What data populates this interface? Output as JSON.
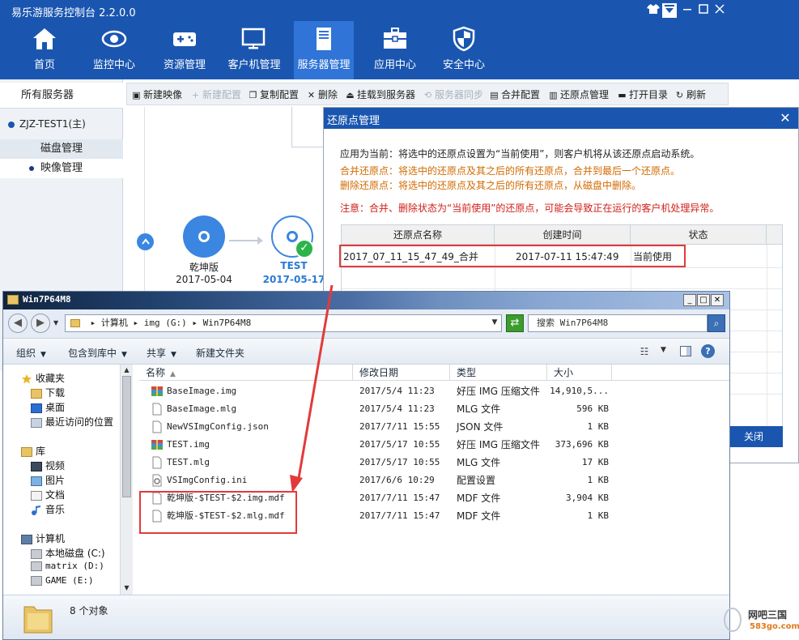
{
  "app": {
    "title": "易乐游服务控制台 2.2.0.0",
    "nav": [
      {
        "label": "首页",
        "icon": "home-icon"
      },
      {
        "label": "监控中心",
        "icon": "eye-icon"
      },
      {
        "label": "资源管理",
        "icon": "gamepad-icon"
      },
      {
        "label": "客户机管理",
        "icon": "monitor-icon"
      },
      {
        "label": "服务器管理",
        "icon": "server-icon",
        "active": true
      },
      {
        "label": "应用中心",
        "icon": "toolbox-icon"
      },
      {
        "label": "安全中心",
        "icon": "shield-icon"
      }
    ]
  },
  "sidebar": {
    "all_servers": "所有服务器",
    "server": "ZJZ-TEST1(主)",
    "disk_mgmt": "磁盘管理",
    "image_mgmt": "映像管理"
  },
  "toolbar": {
    "new_image": "新建映像",
    "new_config": "新建配置",
    "copy_config": "复制配置",
    "delete": "删除",
    "mount": "挂载到服务器",
    "sync": "服务器同步",
    "merge": "合并配置",
    "restore_mgmt": "还原点管理",
    "open_dir": "打开目录",
    "refresh": "刷新"
  },
  "canvas": {
    "node_a": {
      "name": "乾坤版",
      "date": "2017-05-04"
    },
    "node_b": {
      "name": "TEST",
      "date": "2017-05-17"
    }
  },
  "dialog": {
    "title": "还原点管理",
    "line1": "应用为当前：将选中的还原点设置为“当前使用”，则客户机将从该还原点启动系统。",
    "line2": "合并还原点：将选中的还原点及其之后的所有还原点，合并到最后一个还原点。",
    "line3": "删除还原点：将选中的还原点及其之后的所有还原点，从磁盘中删除。",
    "line4": "注意：合并、删除状态为“当前使用”的还原点，可能会导致正在运行的客户机处理异常。",
    "columns": {
      "name": "还原点名称",
      "time": "创建时间",
      "status": "状态"
    },
    "rows": [
      {
        "name": "2017_07_11_15_47_49_合并",
        "time": "2017-07-11 15:47:49",
        "status": "当前使用"
      }
    ],
    "close_button": "关闭"
  },
  "explorer": {
    "title": "Win7P64M8",
    "address": [
      "计算机",
      "img (G:)",
      "Win7P64M8"
    ],
    "search_placeholder": "搜索 Win7P64M8",
    "commands": {
      "organize": "组织",
      "include_library": "包含到库中",
      "share": "共享",
      "new_folder": "新建文件夹"
    },
    "tree": {
      "favorites": "收藏夹",
      "downloads": "下载",
      "desktop": "桌面",
      "recent": "最近访问的位置",
      "libraries": "库",
      "videos": "视频",
      "pictures": "图片",
      "documents": "文档",
      "music": "音乐",
      "computer": "计算机",
      "drive_c": "本地磁盘 (C:)",
      "drive_d": "matrix (D:)",
      "drive_e": "GAME (E:)"
    },
    "columns": {
      "name": "名称",
      "date": "修改日期",
      "type": "类型",
      "size": "大小"
    },
    "files": [
      {
        "name": "BaseImage.img",
        "date": "2017/5/4 11:23",
        "type": "好压 IMG 压缩文件",
        "size": "14,910,5...",
        "icon": "archive-icon"
      },
      {
        "name": "BaseImage.mlg",
        "date": "2017/5/4 11:23",
        "type": "MLG 文件",
        "size": "596 KB",
        "icon": "file-icon"
      },
      {
        "name": "NewVSImgConfig.json",
        "date": "2017/7/11 15:55",
        "type": "JSON 文件",
        "size": "1 KB",
        "icon": "file-icon"
      },
      {
        "name": "TEST.img",
        "date": "2017/5/17 10:55",
        "type": "好压 IMG 压缩文件",
        "size": "373,696 KB",
        "icon": "archive-icon"
      },
      {
        "name": "TEST.mlg",
        "date": "2017/5/17 10:55",
        "type": "MLG 文件",
        "size": "17 KB",
        "icon": "file-icon"
      },
      {
        "name": "VSImgConfig.ini",
        "date": "2017/6/6 10:29",
        "type": "配置设置",
        "size": "1 KB",
        "icon": "settings-file-icon"
      },
      {
        "name": "乾坤版-$TEST-$2.img.mdf",
        "date": "2017/7/11 15:47",
        "type": "MDF 文件",
        "size": "3,904 KB",
        "icon": "file-icon"
      },
      {
        "name": "乾坤版-$TEST-$2.mlg.mdf",
        "date": "2017/7/11 15:47",
        "type": "MDF 文件",
        "size": "1 KB",
        "icon": "file-icon"
      }
    ],
    "status": "8 个对象"
  },
  "watermark": {
    "name": "网吧三国",
    "url": "583go.com"
  },
  "colors": {
    "primary": "#1a56b0",
    "active_nav": "#2f74d6",
    "highlight": "#e23a3a",
    "warn": "#d26a00",
    "error": "#d0201a"
  }
}
